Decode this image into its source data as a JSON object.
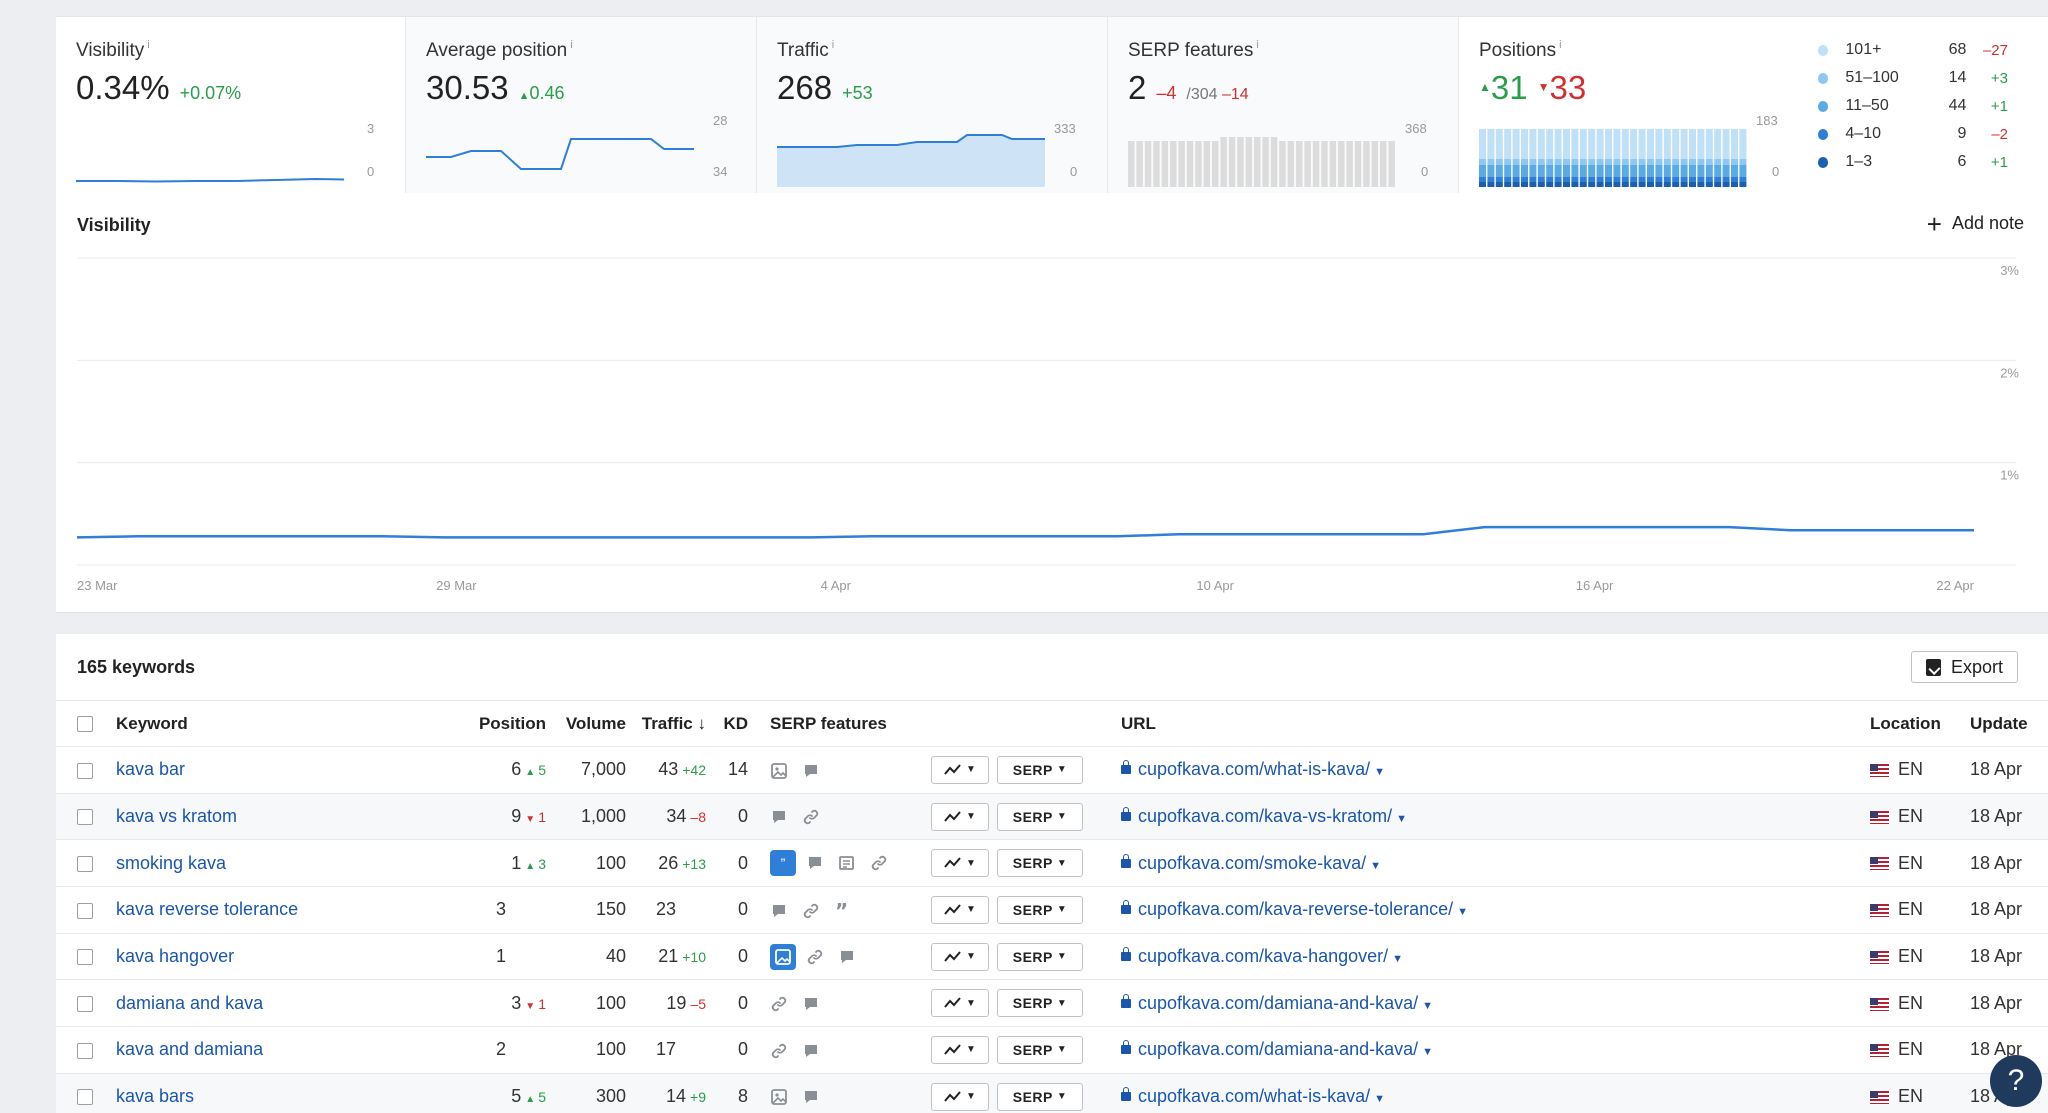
{
  "metrics": {
    "visibility": {
      "label": "Visibility",
      "info": "i",
      "value": "0.34%",
      "delta": "+0.07%",
      "axis_top": "3",
      "axis_bottom": "0"
    },
    "avg_position": {
      "label": "Average position",
      "info": "i",
      "value": "30.53",
      "delta": "0.46",
      "axis_top": "28",
      "axis_bottom": "34"
    },
    "traffic": {
      "label": "Traffic",
      "info": "i",
      "value": "268",
      "delta": "+53",
      "axis_top": "333",
      "axis_bottom": "0"
    },
    "serp_features": {
      "label": "SERP features",
      "info": "i",
      "value": "2",
      "delta": "–4",
      "total": "/304",
      "total_delta": "–14",
      "axis_top": "368",
      "axis_bottom": "0"
    },
    "positions": {
      "label": "Positions",
      "info": "i",
      "up": "31",
      "down": "33",
      "axis_top": "183",
      "axis_bottom": "0"
    }
  },
  "positions_legend": [
    {
      "label": "101+",
      "count": "68",
      "delta": "–27",
      "color": "#bfe0f7",
      "dir": "down"
    },
    {
      "label": "51–100",
      "count": "14",
      "delta": "+3",
      "color": "#8cc8f0",
      "dir": "up"
    },
    {
      "label": "11–50",
      "count": "44",
      "delta": "+1",
      "color": "#5aaae6",
      "dir": "up"
    },
    {
      "label": "4–10",
      "count": "9",
      "delta": "–2",
      "color": "#2f7ed8",
      "dir": "down"
    },
    {
      "label": "1–3",
      "count": "6",
      "delta": "+1",
      "color": "#1b5fb0",
      "dir": "up"
    }
  ],
  "visibility_chart": {
    "title": "Visibility",
    "add_note": "Add note",
    "chart_data": {
      "type": "line",
      "title": "Visibility",
      "x_ticks": [
        "23 Mar",
        "29 Mar",
        "4 Apr",
        "10 Apr",
        "16 Apr",
        "22 Apr"
      ],
      "y_ticks": [
        "3%",
        "2%",
        "1%"
      ],
      "ylim": [
        0,
        3
      ],
      "series": [
        {
          "values": [
            0.27,
            0.28,
            0.28,
            0.28,
            0.28,
            0.28,
            0.27,
            0.27,
            0.27,
            0.27,
            0.27,
            0.27,
            0.27,
            0.28,
            0.28,
            0.28,
            0.28,
            0.28,
            0.3,
            0.3,
            0.3,
            0.3,
            0.3,
            0.37,
            0.37,
            0.37,
            0.37,
            0.37,
            0.34,
            0.34,
            0.34,
            0.34
          ]
        }
      ]
    }
  },
  "keywords": {
    "title": "165 keywords",
    "export": "Export",
    "columns": {
      "keyword": "Keyword",
      "position": "Position",
      "volume": "Volume",
      "traffic": "Traffic ↓",
      "kd": "KD",
      "serp_features": "SERP features",
      "url": "URL",
      "location": "Location",
      "update": "Update"
    },
    "serp_button": "SERP",
    "rows": [
      {
        "keyword": "kava bar",
        "position": "6",
        "pos_delta": "5",
        "pos_dir": "up",
        "volume": "7,000",
        "traffic": "43",
        "traffic_delta": "+42",
        "traffic_dir": "up",
        "kd": "14",
        "features": [
          "image-icon",
          "comment-icon"
        ],
        "url": "cupofkava.com/what-is-kava/",
        "location": "EN",
        "update": "18 Apr"
      },
      {
        "keyword": "kava vs kratom",
        "position": "9",
        "pos_delta": "1",
        "pos_dir": "down",
        "volume": "1,000",
        "traffic": "34",
        "traffic_delta": "–8",
        "traffic_dir": "down",
        "kd": "0",
        "features": [
          "comment-icon",
          "link-icon"
        ],
        "url": "cupofkava.com/kava-vs-kratom/",
        "location": "EN",
        "update": "18 Apr"
      },
      {
        "keyword": "smoking kava",
        "position": "1",
        "pos_delta": "3",
        "pos_dir": "up",
        "volume": "100",
        "traffic": "26",
        "traffic_delta": "+13",
        "traffic_dir": "up",
        "kd": "0",
        "features": [
          "quote-icon-active",
          "comment-icon",
          "news-icon",
          "link-icon"
        ],
        "url": "cupofkava.com/smoke-kava/",
        "location": "EN",
        "update": "18 Apr"
      },
      {
        "keyword": "kava reverse tolerance",
        "position": "3",
        "pos_delta": "",
        "pos_dir": "",
        "volume": "150",
        "traffic": "23",
        "traffic_delta": "",
        "traffic_dir": "",
        "kd": "0",
        "features": [
          "comment-icon",
          "link-icon",
          "quote-icon"
        ],
        "url": "cupofkava.com/kava-reverse-tolerance/",
        "location": "EN",
        "update": "18 Apr"
      },
      {
        "keyword": "kava hangover",
        "position": "1",
        "pos_delta": "",
        "pos_dir": "",
        "volume": "40",
        "traffic": "21",
        "traffic_delta": "+10",
        "traffic_dir": "up",
        "kd": "0",
        "features": [
          "image-icon-active",
          "link-icon",
          "comment-icon"
        ],
        "url": "cupofkava.com/kava-hangover/",
        "location": "EN",
        "update": "18 Apr"
      },
      {
        "keyword": "damiana and kava",
        "position": "3",
        "pos_delta": "1",
        "pos_dir": "down",
        "volume": "100",
        "traffic": "19",
        "traffic_delta": "–5",
        "traffic_dir": "down",
        "kd": "0",
        "features": [
          "link-icon",
          "comment-icon"
        ],
        "url": "cupofkava.com/damiana-and-kava/",
        "location": "EN",
        "update": "18 Apr"
      },
      {
        "keyword": "kava and damiana",
        "position": "2",
        "pos_delta": "",
        "pos_dir": "",
        "volume": "100",
        "traffic": "17",
        "traffic_delta": "",
        "traffic_dir": "",
        "kd": "0",
        "features": [
          "link-icon",
          "comment-icon"
        ],
        "url": "cupofkava.com/damiana-and-kava/",
        "location": "EN",
        "update": "18 Apr"
      },
      {
        "keyword": "kava bars",
        "position": "5",
        "pos_delta": "5",
        "pos_dir": "up",
        "volume": "300",
        "traffic": "14",
        "traffic_delta": "+9",
        "traffic_dir": "up",
        "kd": "8",
        "features": [
          "image-icon",
          "comment-icon"
        ],
        "url": "cupofkava.com/what-is-kava/",
        "location": "EN",
        "update": "18 Apr"
      }
    ]
  },
  "help": "?"
}
